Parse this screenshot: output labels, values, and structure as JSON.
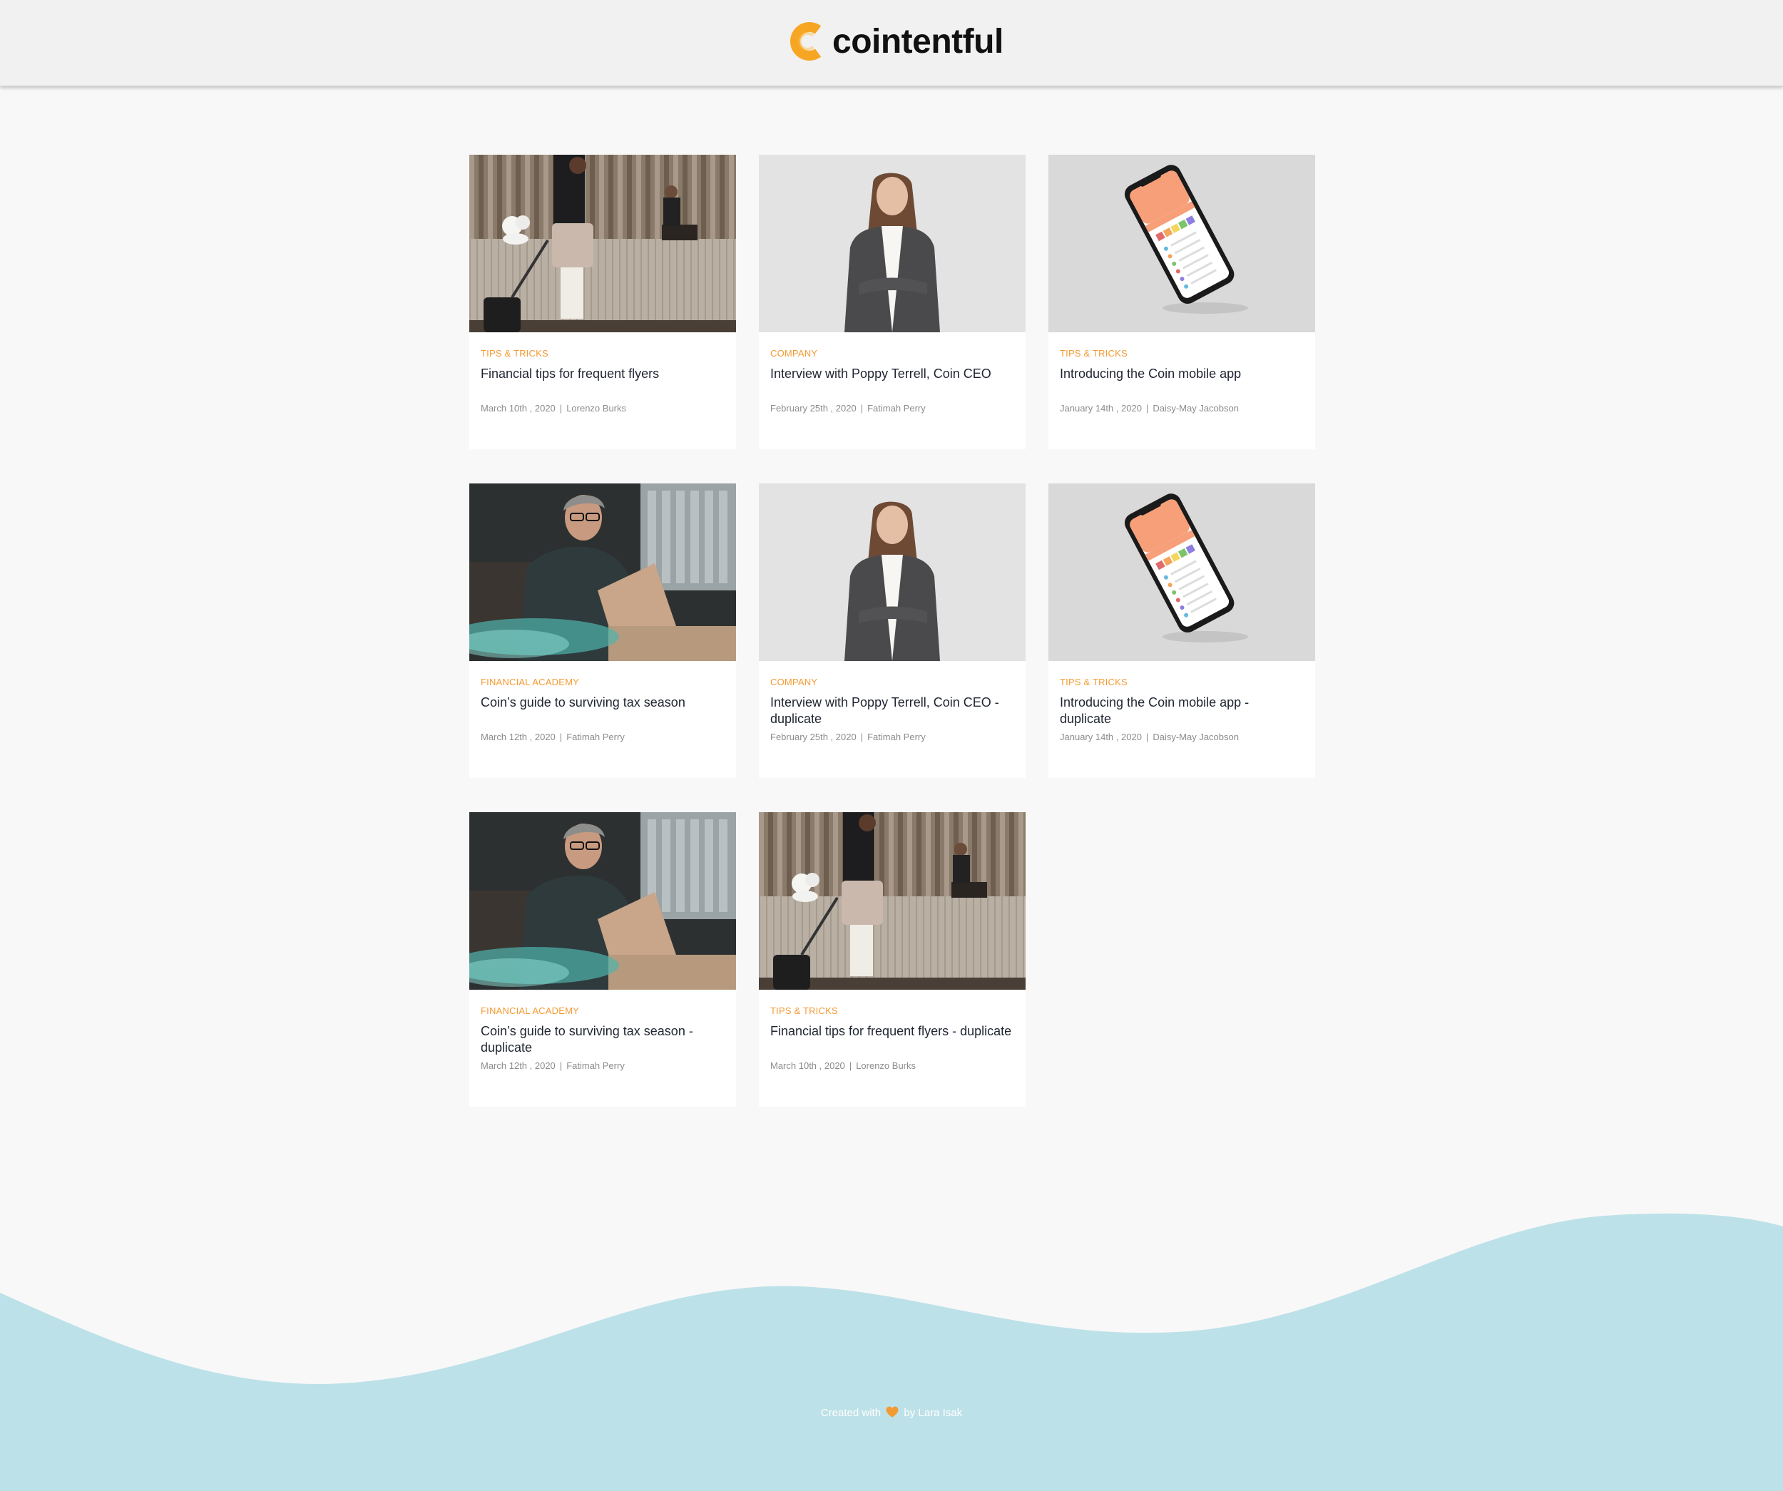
{
  "brand": {
    "name": "cointentful",
    "logo_icon": "coin-c-logo",
    "logo_color": "#f7a623"
  },
  "colors": {
    "accent": "#f39b33",
    "wave": "#bde1e8",
    "background": "#f8f8f8",
    "header": "#f1f1f1"
  },
  "posts": [
    {
      "category": "Tips & Tricks",
      "title": "Financial tips for frequent flyers",
      "date": "March 10th , 2020",
      "author": "Lorenzo Burks",
      "image": "traveler-photo"
    },
    {
      "category": "Company",
      "title": "Interview with Poppy Terrell, Coin CEO",
      "date": "February 25th , 2020",
      "author": "Fatimah Perry",
      "image": "ceo-portrait-photo"
    },
    {
      "category": "Tips & Tricks",
      "title": "Introducing the Coin mobile app",
      "date": "January 14th , 2020",
      "author": "Daisy-May Jacobson",
      "image": "mobile-app-photo"
    },
    {
      "category": "Financial Academy",
      "title": "Coin’s guide to surviving tax season",
      "date": "March 12th , 2020",
      "author": "Fatimah Perry",
      "image": "laptop-man-photo"
    },
    {
      "category": "Company",
      "title": "Interview with Poppy Terrell, Coin CEO - duplicate",
      "date": "February 25th , 2020",
      "author": "Fatimah Perry",
      "image": "ceo-portrait-photo"
    },
    {
      "category": "Tips & Tricks",
      "title": "Introducing the Coin mobile app - duplicate",
      "date": "January 14th , 2020",
      "author": "Daisy-May Jacobson",
      "image": "mobile-app-photo"
    },
    {
      "category": "Financial Academy",
      "title": "Coin’s guide to surviving tax season - duplicate",
      "date": "March 12th , 2020",
      "author": "Fatimah Perry",
      "image": "laptop-man-photo"
    },
    {
      "category": "Tips & Tricks",
      "title": "Financial tips for frequent flyers - duplicate",
      "date": "March 10th , 2020",
      "author": "Lorenzo Burks",
      "image": "traveler-photo"
    }
  ],
  "footer": {
    "prefix": "Created with",
    "heart_icon": "heart-icon",
    "suffix": "by Lara Isak"
  }
}
